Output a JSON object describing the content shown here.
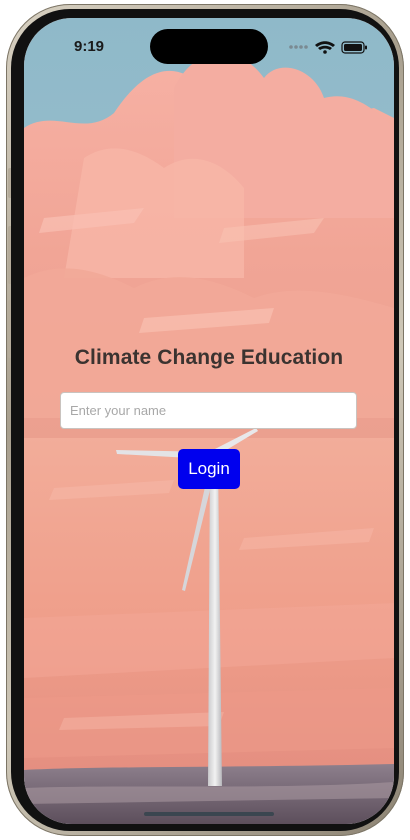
{
  "status_bar": {
    "time": "9:19",
    "icons": [
      "cellular-dots-icon",
      "wifi-icon",
      "battery-icon"
    ]
  },
  "login_screen": {
    "title": "Climate Change Education",
    "name_input": {
      "placeholder": "Enter your name",
      "value": ""
    },
    "login_label": "Login"
  },
  "colors": {
    "login_button": "#0000ee",
    "title_text": "#3b3330",
    "sky_blue": "#9ec3cf",
    "cloud_pink": "#f0a49a",
    "ground": "#8a7a88"
  }
}
